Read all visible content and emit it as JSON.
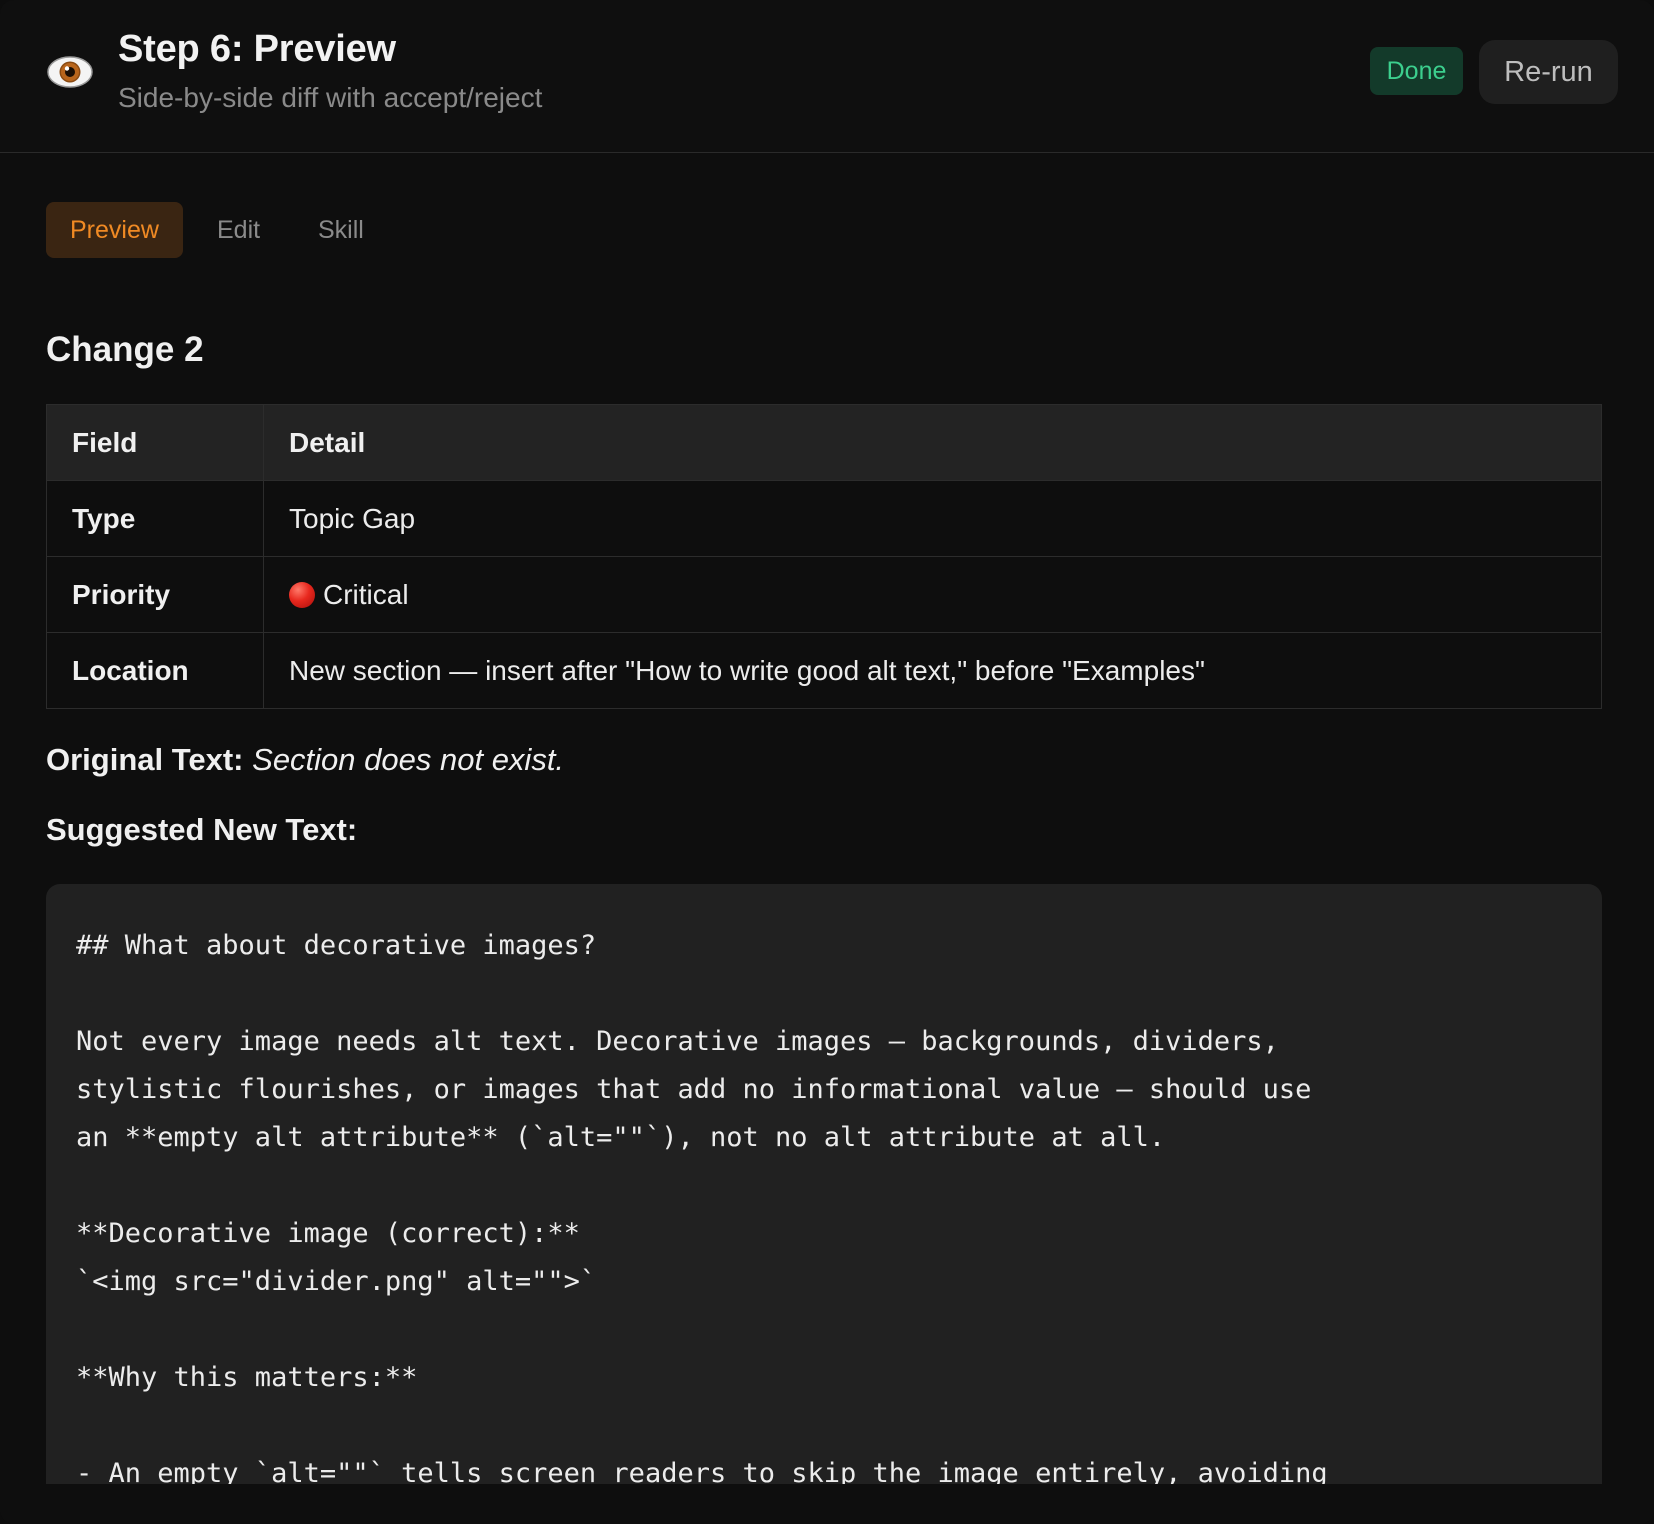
{
  "header": {
    "icon": "eye-icon",
    "title": "Step 6: Preview",
    "subtitle": "Side-by-side diff with accept/reject",
    "status_badge": "Done",
    "rerun_label": "Re-run"
  },
  "tabs": [
    {
      "label": "Preview",
      "active": true
    },
    {
      "label": "Edit",
      "active": false
    },
    {
      "label": "Skill",
      "active": false
    }
  ],
  "change": {
    "heading": "Change 2",
    "table": {
      "headers": [
        "Field",
        "Detail"
      ],
      "rows": [
        {
          "field": "Type",
          "detail": "Topic Gap"
        },
        {
          "field": "Priority",
          "detail": "Critical",
          "icon": "red-circle-icon"
        },
        {
          "field": "Location",
          "detail": "New section — insert after \"How to write good alt text,\" before \"Examples\""
        }
      ]
    },
    "original_label": "Original Text:",
    "original_value": "Section does not exist.",
    "suggested_label": "Suggested New Text:",
    "suggested_code": "## What about decorative images?\n\nNot every image needs alt text. Decorative images — backgrounds, dividers,\nstylistic flourishes, or images that add no informational value — should use\nan **empty alt attribute** (`alt=\"\"`), not no alt attribute at all.\n\n**Decorative image (correct):**\n`<img src=\"divider.png\" alt=\"\">`\n\n**Why this matters:**\n\n- An empty `alt=\"\"` tells screen readers to skip the image entirely, avoiding"
  },
  "colors": {
    "background": "#0e0e0e",
    "accent_orange": "#f08a24",
    "done_green": "#3ccf8e",
    "code_bg": "#212121"
  }
}
